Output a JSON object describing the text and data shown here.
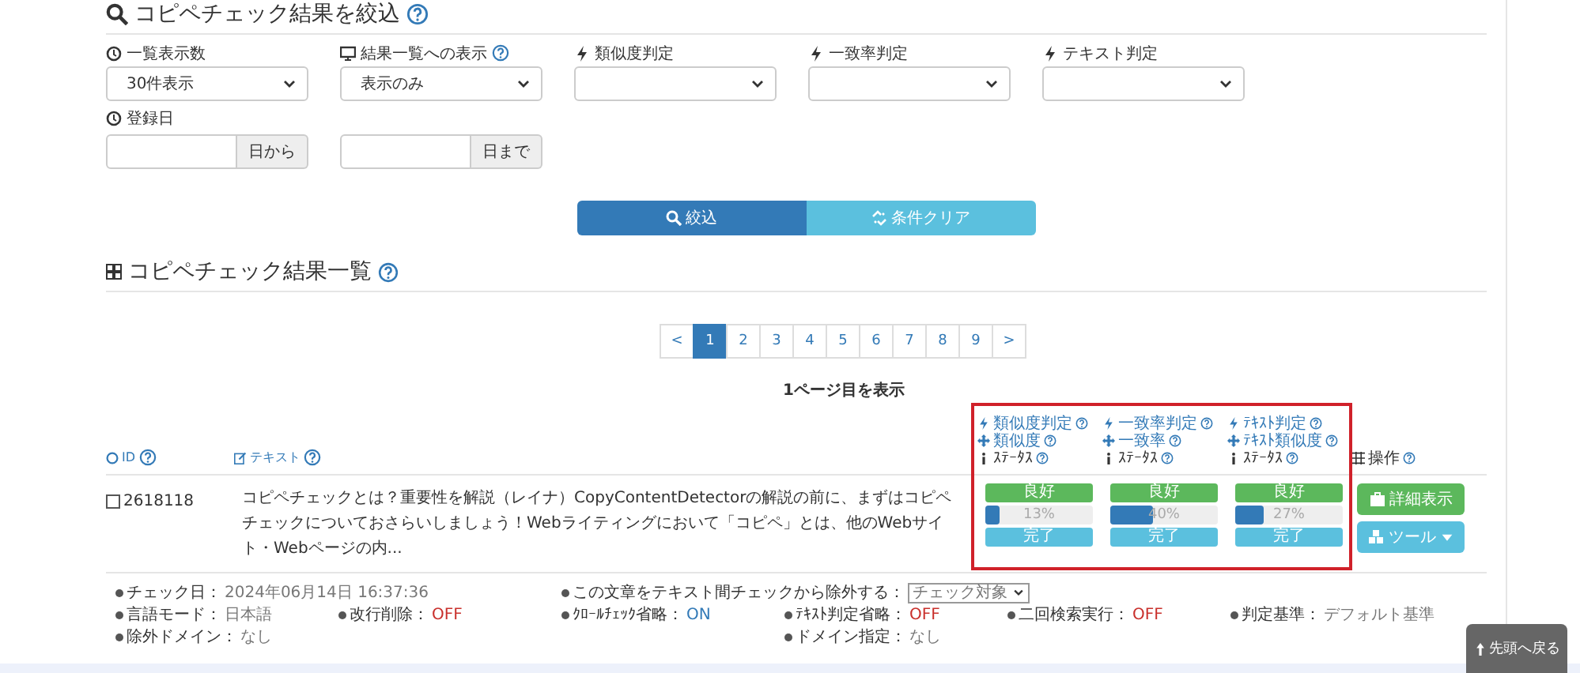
{
  "filter_title": "コピペチェック結果を絞込",
  "filters": [
    {
      "label": "一覧表示数",
      "value": "30件表示",
      "help": false
    },
    {
      "label": "結果一覧への表示",
      "value": "表示のみ",
      "help": true
    },
    {
      "label": "類似度判定",
      "help": false
    },
    {
      "label": "一致率判定",
      "help": false
    },
    {
      "label": "テキスト判定",
      "help": false
    }
  ],
  "date_filter": {
    "label": "登録日",
    "from_addon": "日から",
    "to_addon": "日まで"
  },
  "buttons": [
    {
      "label": "絞込",
      "kind": "primary"
    },
    {
      "label": "条件クリア",
      "kind": "secondary"
    }
  ],
  "results_title": "コピペチェック結果一覧",
  "pagination": {
    "prev": "<",
    "next": ">",
    "pages": [
      {
        "label": "1",
        "selected": true
      },
      {
        "label": "2",
        "selected": false
      },
      {
        "label": "3",
        "selected": false
      },
      {
        "label": "4",
        "selected": false
      },
      {
        "label": "5",
        "selected": false
      },
      {
        "label": "6",
        "selected": false
      },
      {
        "label": "7",
        "selected": false
      },
      {
        "label": "8",
        "selected": false
      },
      {
        "label": "9",
        "selected": false
      }
    ]
  },
  "page_info": "1ページ目を表示",
  "table": {
    "columns": [
      {
        "label": "ID",
        "help": true
      },
      {
        "label": "テキスト",
        "help": true
      }
    ],
    "judgment_columns": [
      {
        "lines": [
          {
            "text": "類似度判定",
            "help": true
          },
          {
            "text": "類似度",
            "help": true
          },
          {
            "text": "ｽﾃｰﾀｽ",
            "help": true
          }
        ]
      },
      {
        "lines": [
          {
            "text": "一致率判定",
            "help": true
          },
          {
            "text": "一致率",
            "help": true
          },
          {
            "text": "ｽﾃｰﾀｽ",
            "help": true
          }
        ]
      },
      {
        "lines": [
          {
            "text": "ﾃｷｽﾄ判定",
            "help": true
          },
          {
            "text": "ﾃｷｽﾄ類似度",
            "help": true
          },
          {
            "text": "ｽﾃｰﾀｽ",
            "help": true
          }
        ]
      }
    ],
    "actions_column": {
      "label": "操作",
      "help": true
    },
    "rows": [
      {
        "checked": false,
        "id": "2618118",
        "text": "コピペチェックとは？重要性を解説（レイナ）CopyContentDetectorの解説の前に、まずはコピペチェックについておさらいしましょう！Webライティングにおいて「コピペ」とは、他のWebサイト・Webページの内...",
        "judgments": [
          {
            "status": "良好",
            "level": 0.13,
            "reading": "13%",
            "progress": "完了"
          },
          {
            "status": "良好",
            "level": 0.4,
            "reading": "40%",
            "progress": "完了"
          },
          {
            "status": "良好",
            "level": 0.27,
            "reading": "27%",
            "progress": "完了"
          }
        ],
        "detail_button": "詳細表示",
        "tool_button": "ツール"
      }
    ]
  },
  "details": [
    [
      {
        "label": "チェック日：",
        "value": "2024年06月14日 16:37:36",
        "color": "#777777"
      },
      {
        "label": "この文章をテキスト間チェックから除外する：",
        "select": "チェック対象"
      }
    ],
    [
      {
        "label": "言語モード：",
        "value": "日本語",
        "color": "#777777"
      },
      {
        "label": "改行削除：",
        "value": "OFF",
        "color": "#c9302c"
      },
      {
        "label": "ｸﾛｰﾙﾁｪｯｸ省略：",
        "value": "ON",
        "color": "#337ab7"
      },
      {
        "label": "ﾃｷｽﾄ判定省略：",
        "value": "OFF",
        "color": "#c9302c"
      },
      {
        "label": "二回検索実行：",
        "value": "OFF",
        "color": "#c9302c"
      },
      {
        "label": "判定基準：",
        "value": "デフォルト基準",
        "color": "#777777"
      }
    ],
    [
      {
        "label": "除外ドメイン：",
        "value": "なし",
        "color": "#777777"
      },
      {
        "label": "ドメイン指定：",
        "value": "なし",
        "color": "#777777"
      }
    ]
  ],
  "back_to_top": "先頭へ戻る"
}
